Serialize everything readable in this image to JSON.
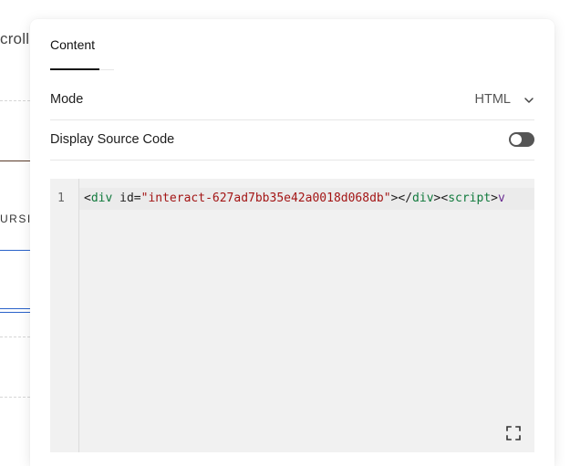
{
  "background": {
    "scroll_fragment": "crolli",
    "curs_fragment": "URSI"
  },
  "panel": {
    "tabs": [
      {
        "label": "Content",
        "active": true
      }
    ],
    "mode": {
      "label": "Mode",
      "value": "HTML",
      "icon": "chevron-down-icon"
    },
    "display_source": {
      "label": "Display Source Code",
      "enabled": false
    },
    "editor": {
      "line_number": "1",
      "tokens": {
        "open1": "<",
        "tag1": "div",
        "space": " ",
        "attr": "id",
        "eq": "=",
        "value": "\"interact-627ad7bb35e42a0018d068db\"",
        "close1": ">",
        "open2": "</",
        "tag2": "div",
        "close2": ">",
        "open3": "<",
        "tag3": "script",
        "close3": ">",
        "tail": "v"
      },
      "expand_icon": "fullscreen-icon"
    }
  },
  "colors": {
    "toggle_off": "#555555",
    "tag": "#117a3d",
    "string": "#a31515",
    "script_tail": "#6a2c91"
  }
}
